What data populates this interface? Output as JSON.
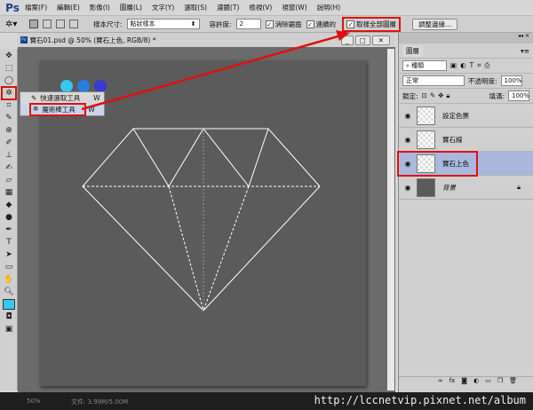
{
  "app": {
    "logo": "Ps"
  },
  "menu": [
    "檔案(F)",
    "編輯(E)",
    "影像(I)",
    "圖層(L)",
    "文字(Y)",
    "選取(S)",
    "濾鏡(T)",
    "檢視(V)",
    "視窗(W)",
    "說明(H)"
  ],
  "options": {
    "sample_size_label": "樣本尺寸:",
    "sample_size_value": "點狀樣本",
    "tolerance_label": "容許度:",
    "tolerance_value": "2",
    "anti_alias": "消除鋸齒",
    "contiguous": "連續的",
    "sample_all_layers": "取樣全部圖層",
    "refine_edge": "調整邊緣..."
  },
  "document": {
    "tab_title": "寶石01.psd @ 50% (寶石上色, RGB/8) *",
    "swatches": [
      "#35c8f0",
      "#2a7de0",
      "#3a3ad0"
    ]
  },
  "flyout": {
    "items": [
      {
        "label": "快速選取工具",
        "key": "W"
      },
      {
        "label": "魔術棒工具",
        "key": "W"
      }
    ]
  },
  "layers_panel": {
    "tab": "圖層",
    "kind": "種類",
    "blend_mode": "正常",
    "opacity_label": "不透明度:",
    "opacity": "100%",
    "lock_label": "鎖定:",
    "fill_label": "填滿:",
    "fill": "100%",
    "layers": [
      {
        "name": "設定色票"
      },
      {
        "name": "寶石線"
      },
      {
        "name": "寶石上色",
        "selected": true
      },
      {
        "name": "背景",
        "locked": true
      }
    ]
  },
  "status": {
    "zoom": "50%",
    "doc_size": "文件: 3.99M/5.00M"
  },
  "watermark": "http://lccnetvip.pixnet.net/album",
  "colors": {
    "highlight": "#e01010",
    "foreground": "#35c8f0",
    "selected_layer": "#a9b8dc"
  }
}
